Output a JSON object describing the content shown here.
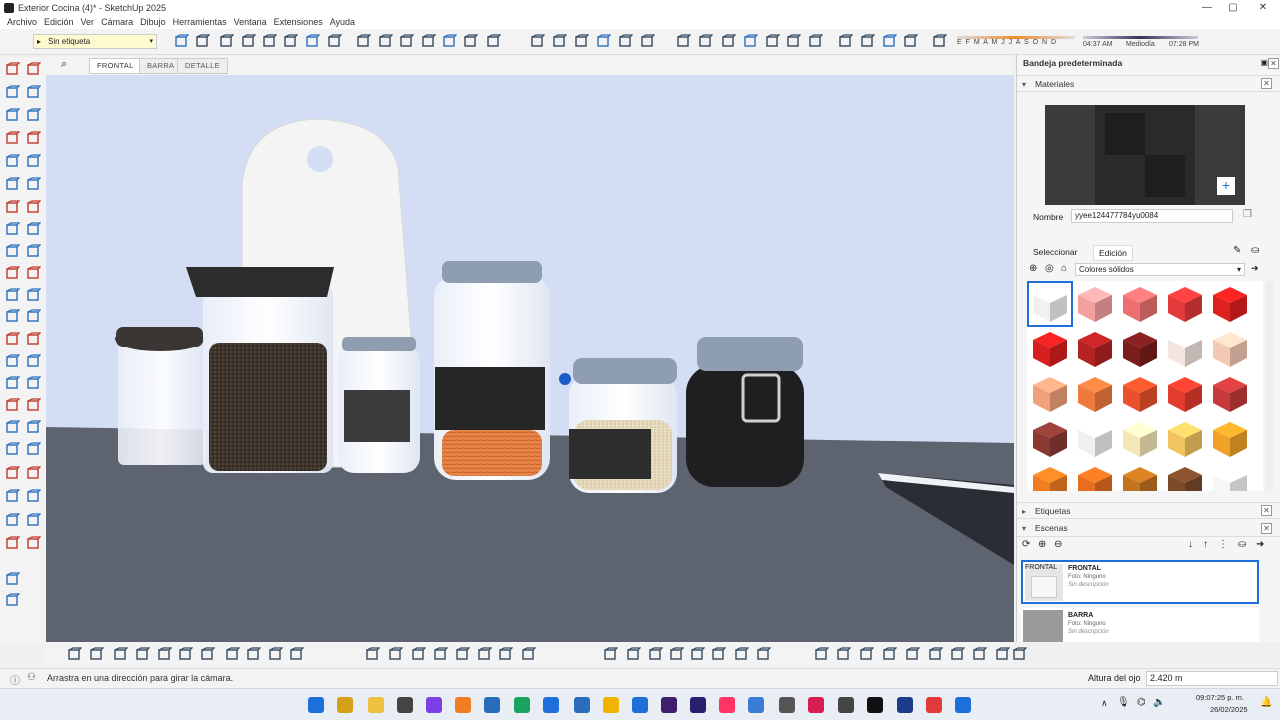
{
  "window": {
    "title": "Exterior Cocina (4)* - SketchUp 2025",
    "controls": [
      "—",
      "▢",
      "✕"
    ]
  },
  "menu": [
    "Archivo",
    "Edición",
    "Ver",
    "Cámara",
    "Dibujo",
    "Herramientas",
    "Ventana",
    "Extensiones",
    "Ayuda"
  ],
  "toolbar": {
    "tag_value": "Sin etiqueta",
    "sun": {
      "months": "E F M A M J J A S O N D",
      "time_start": "04:37 AM",
      "mid": "Mediodía",
      "time_end": "07:28 PM"
    }
  },
  "scene_tabs": [
    "FRONTAL",
    "BARRA",
    "DETALLE"
  ],
  "tray": {
    "title": "Bandeja predeterminada",
    "materials": {
      "header": "Materiales",
      "name_label": "Nombre",
      "name_value": "yyee124477784yu0084",
      "tab_select": "Seleccionar",
      "tab_edit": "Edición",
      "library": "Colores sólidos"
    },
    "tags_header": "Etiquetas",
    "scenes": {
      "header": "Escenas",
      "items": [
        {
          "thumb": "FRONTAL",
          "name": "FRONTAL",
          "photo": "Foto: Ninguno",
          "desc": "Sin descripción"
        },
        {
          "thumb": "",
          "name": "BARRA",
          "photo": "Foto: Ninguno",
          "desc": "Sin descripción"
        }
      ]
    }
  },
  "colors": {
    "accent": "#1e6fd9",
    "swatches": [
      "#f1f1f1",
      "#f2a0a0",
      "#ec7070",
      "#e23a3a",
      "#e01f1f",
      "#d81f1f",
      "#b42222",
      "#7a1d1d",
      "#f3e6e0",
      "#f3c9b5",
      "#f0a07a",
      "#ee7a3e",
      "#e8512b",
      "#e13c2e",
      "#c63a3a",
      "#8b3a33",
      "#f0f0f0",
      "#f5e6b8",
      "#f2c460",
      "#f0a128",
      "#f07d22",
      "#e56e20",
      "#c2731f",
      "#7a4a2a",
      "#f6f6f6"
    ]
  },
  "status": {
    "hint": "Arrastra en una dirección para girar la cámara.",
    "eye_label": "Altura del ojo",
    "eye_value": "2.420 m"
  },
  "taskbar": {
    "clock_time": "09:07:25 p. m.",
    "clock_date": "26/02/2025"
  }
}
